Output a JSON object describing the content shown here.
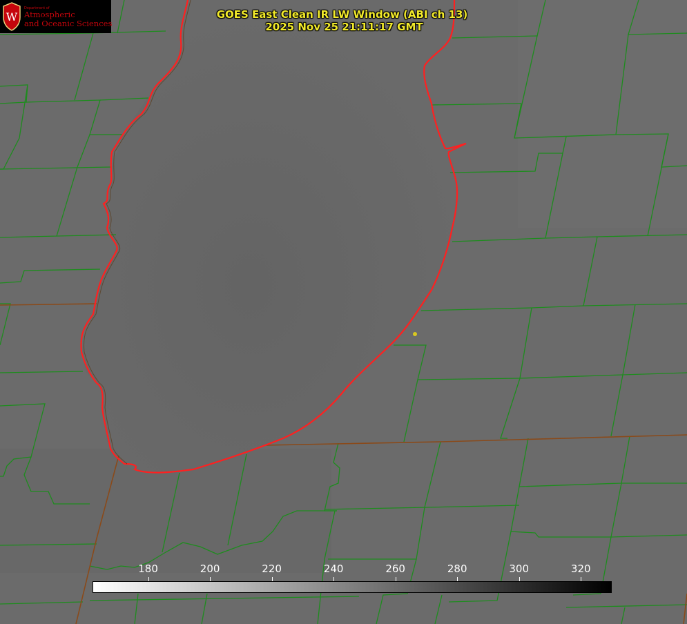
{
  "title": {
    "line1": "GOES East Clean IR LW Window (ABI ch 13)",
    "line2": "2025 Nov 25 21:11:17 GMT"
  },
  "logo": {
    "dept": "Department of",
    "line1": "Atmospheric",
    "line2": "and Oceanic Sciences",
    "crest_letter": "W"
  },
  "colorbar": {
    "min": 162,
    "max": 330,
    "ticks": [
      "180",
      "200",
      "220",
      "240",
      "260",
      "280",
      "300",
      "320"
    ],
    "gradient": [
      "#ffffff",
      "#000000"
    ]
  },
  "colors": {
    "background": "#6a6a6a",
    "county_lines": "#1e8c1e",
    "state_lines": "#8a4a1a",
    "coastline": "#ff2020",
    "title_text": "#f2ea2a",
    "logo_red": "#c5050c",
    "marker": "#d9c820"
  }
}
